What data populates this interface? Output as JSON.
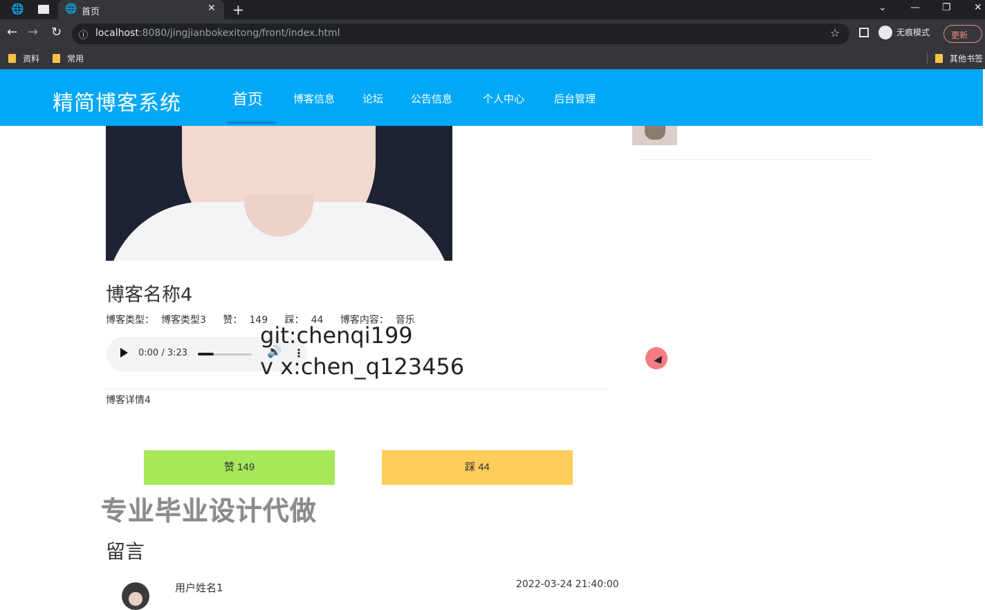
{
  "browser": {
    "tab_title": "首页",
    "url_host": "localhost",
    "url_rest": ":8080/jingjianbokexitong/front/index.html",
    "incognito_label": "无痕模式",
    "update_label": "更新",
    "bookmarks": [
      "资料",
      "常用"
    ],
    "other_bookmarks": "其他书签"
  },
  "site": {
    "logo": "精简博客系统",
    "nav": [
      "首页",
      "博客信息",
      "论坛",
      "公告信息",
      "个人中心",
      "后台管理"
    ]
  },
  "blog": {
    "title": "博客名称4",
    "type_label": "博客类型：",
    "type_value": "博客类型3",
    "like_label": "赞：",
    "like_value": "149",
    "dislike_label": "踩：",
    "dislike_value": "44",
    "content_label": "博客内容：",
    "content_value": "音乐",
    "audio_time": "0:00 / 3:23",
    "audio_progress": 0.3,
    "detail": "博客详情4",
    "like_button": "赞   149",
    "dislike_button": "踩   44"
  },
  "overlay": {
    "git": "git:chenqi199",
    "wx": "v x:chen_q123456",
    "promo": "专业毕业设计代做"
  },
  "comments": {
    "title": "留言",
    "items": [
      {
        "user": "用户姓名1",
        "time": "2022-03-24 21:40:00"
      }
    ]
  },
  "colors": {
    "header": "#00a8f7",
    "like": "#a6e85a",
    "dislike": "#ffcd59"
  }
}
